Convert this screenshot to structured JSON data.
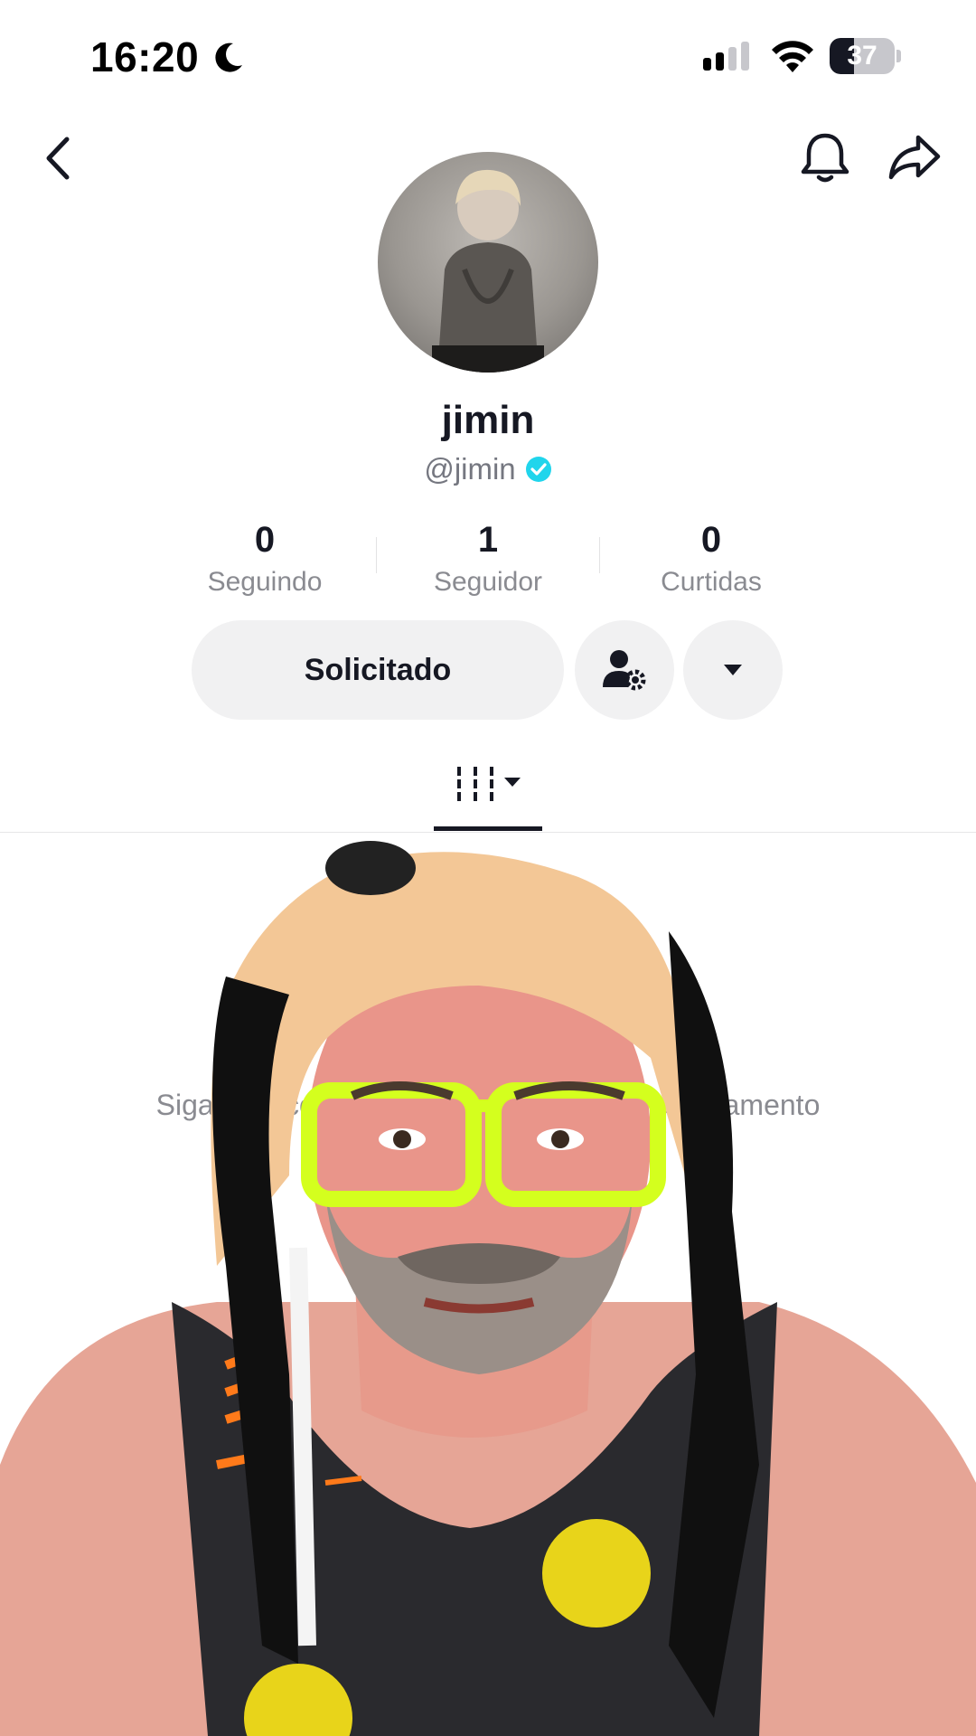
{
  "status_bar": {
    "time": "16:20",
    "battery": "37",
    "battery_level": 0.37,
    "icons": [
      "moon-icon",
      "signal-icon",
      "wifi-icon",
      "battery-icon"
    ]
  },
  "header": {
    "icons": [
      "back-icon",
      "bell-icon",
      "share-icon"
    ]
  },
  "profile": {
    "display_name": "jimin",
    "handle": "@jimin",
    "verified": true,
    "verified_color": "#20d5ec"
  },
  "stats": [
    {
      "value": "0",
      "label": "Seguindo"
    },
    {
      "value": "1",
      "label": "Seguidor"
    },
    {
      "value": "0",
      "label": "Curtidas"
    }
  ],
  "actions": {
    "requested_label": "Solicitado",
    "settings_icon": "user-settings-icon",
    "more_icon": "caret-down-icon"
  },
  "tabs": {
    "videos_icon": "video-grid-icon"
  },
  "content": {
    "empty_message": "Siga esta conta para ver o conteúdo e engajamento"
  },
  "overlay": {
    "description_icon": "person-with-dog-hat-overlay",
    "glasses_color": "#d4ff1e",
    "hat_color": "#f3c796"
  }
}
